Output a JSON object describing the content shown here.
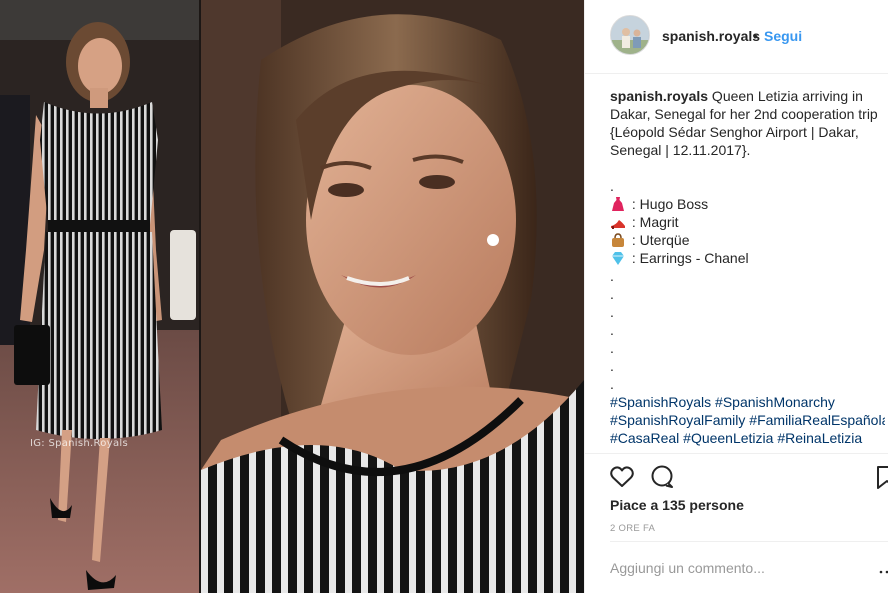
{
  "post": {
    "username": "spanish.royals",
    "separator": "•",
    "follow_label": "Segui",
    "watermark": "IG: Spanish.Royals",
    "caption": {
      "username": "spanish.royals",
      "lines": [
        " Queen Letizia arriving in",
        "Dakar, Senegal for her 2nd cooperation trip",
        "{Léopold Sédar Senghor Airport | Dakar,",
        "Senegal | 12.11.2017}."
      ],
      "dot": ".",
      "credits": [
        {
          "icon": "dress-icon",
          "text": " : Hugo Boss"
        },
        {
          "icon": "high-heel-icon",
          "text": " : Magrit"
        },
        {
          "icon": "handbag-icon",
          "text": " : Uterqüe"
        },
        {
          "icon": "gem-icon",
          "text": " : Earrings - Chanel"
        }
      ],
      "hashtags": [
        "#SpanishRoyals #SpanishMonarchy",
        "#SpanishRoyalFamily #FamiliaRealEspañola",
        "#CasaReal #QueenLetizia #ReinaLetizia"
      ]
    },
    "likes_text": "Piace a 135 persone",
    "timestamp": "2 ORE FA",
    "comment_placeholder": "Aggiungi un commento..."
  },
  "icons": {
    "like": "heart-icon",
    "comment": "comment-icon",
    "save": "bookmark-icon",
    "more": "more-icon"
  },
  "colors": {
    "link": "#3897f0",
    "hashtag": "#003569",
    "text": "#262626",
    "muted": "#999999",
    "border": "#efefef"
  }
}
